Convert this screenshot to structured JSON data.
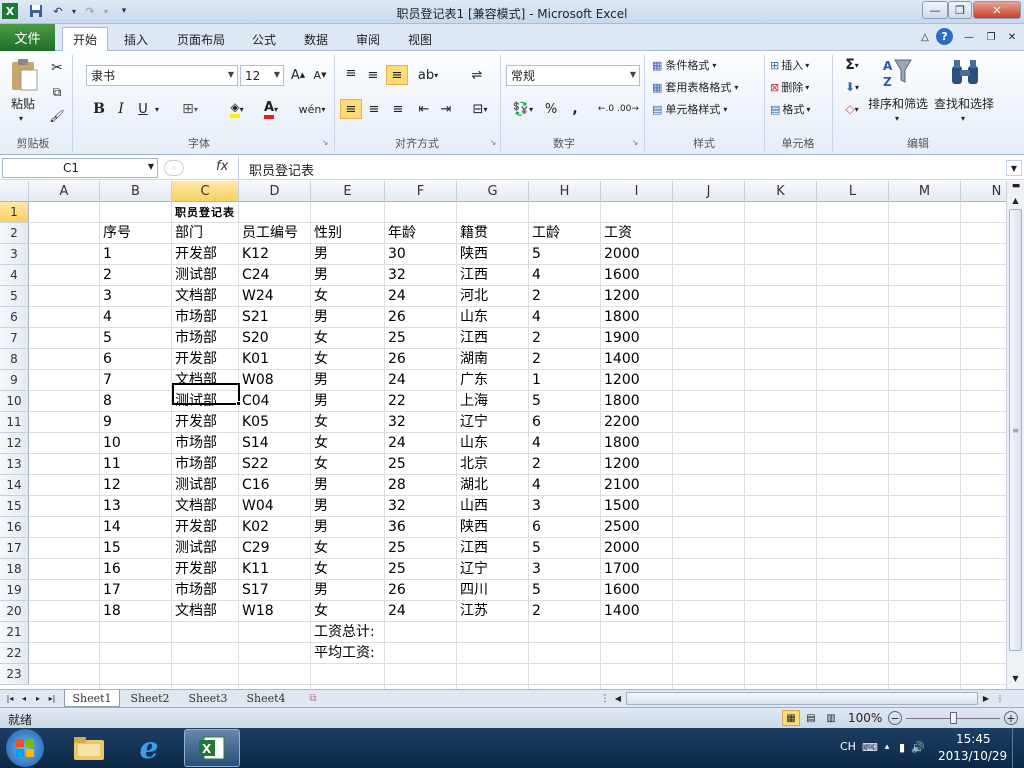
{
  "window": {
    "title": "职员登记表1  [兼容模式]  -  Microsoft Excel"
  },
  "tabs": [
    "文件",
    "开始",
    "插入",
    "页面布局",
    "公式",
    "数据",
    "审阅",
    "视图"
  ],
  "ribbon": {
    "clipboard": {
      "paste": "粘贴",
      "label": "剪贴板"
    },
    "font": {
      "name": "隶书",
      "size": "12",
      "label": "字体",
      "bold": "B",
      "italic": "I",
      "underline": "U"
    },
    "alignment": {
      "label": "对齐方式"
    },
    "number": {
      "format": "常规",
      "label": "数字",
      "percent": "%",
      "comma": ","
    },
    "styles": {
      "conditional": "条件格式",
      "table": "套用表格格式",
      "cell": "单元格样式",
      "label": "样式"
    },
    "cells": {
      "insert": "插入",
      "delete": "删除",
      "format": "格式",
      "label": "单元格"
    },
    "editing": {
      "sort": "排序和筛选",
      "find": "查找和选择",
      "label": "编辑",
      "sum": "Σ"
    }
  },
  "formula_bar": {
    "cell_ref": "C1",
    "fx": "fx",
    "value": "职员登记表"
  },
  "columns": [
    "A",
    "B",
    "C",
    "D",
    "E",
    "F",
    "G",
    "H",
    "I",
    "J",
    "K",
    "L",
    "M",
    "N"
  ],
  "rows": [
    "1",
    "2",
    "3",
    "4",
    "5",
    "6",
    "7",
    "8",
    "9",
    "10",
    "11",
    "12",
    "13",
    "14",
    "15",
    "16",
    "17",
    "18",
    "19",
    "20",
    "21",
    "22",
    "23"
  ],
  "sheet": {
    "title": "职员登记表",
    "headers": [
      "序号",
      "部门",
      "员工编号",
      "性别",
      "年龄",
      "籍贯",
      "工龄",
      "工资"
    ],
    "records": [
      [
        "1",
        "开发部",
        "K12",
        "男",
        "30",
        "陕西",
        "5",
        "2000"
      ],
      [
        "2",
        "测试部",
        "C24",
        "男",
        "32",
        "江西",
        "4",
        "1600"
      ],
      [
        "3",
        "文档部",
        "W24",
        "女",
        "24",
        "河北",
        "2",
        "1200"
      ],
      [
        "4",
        "市场部",
        "S21",
        "男",
        "26",
        "山东",
        "4",
        "1800"
      ],
      [
        "5",
        "市场部",
        "S20",
        "女",
        "25",
        "江西",
        "2",
        "1900"
      ],
      [
        "6",
        "开发部",
        "K01",
        "女",
        "26",
        "湖南",
        "2",
        "1400"
      ],
      [
        "7",
        "文档部",
        "W08",
        "男",
        "24",
        "广东",
        "1",
        "1200"
      ],
      [
        "8",
        "测试部",
        "C04",
        "男",
        "22",
        "上海",
        "5",
        "1800"
      ],
      [
        "9",
        "开发部",
        "K05",
        "女",
        "32",
        "辽宁",
        "6",
        "2200"
      ],
      [
        "10",
        "市场部",
        "S14",
        "女",
        "24",
        "山东",
        "4",
        "1800"
      ],
      [
        "11",
        "市场部",
        "S22",
        "女",
        "25",
        "北京",
        "2",
        "1200"
      ],
      [
        "12",
        "测试部",
        "C16",
        "男",
        "28",
        "湖北",
        "4",
        "2100"
      ],
      [
        "13",
        "文档部",
        "W04",
        "男",
        "32",
        "山西",
        "3",
        "1500"
      ],
      [
        "14",
        "开发部",
        "K02",
        "男",
        "36",
        "陕西",
        "6",
        "2500"
      ],
      [
        "15",
        "测试部",
        "C29",
        "女",
        "25",
        "江西",
        "5",
        "2000"
      ],
      [
        "16",
        "开发部",
        "K11",
        "女",
        "25",
        "辽宁",
        "3",
        "1700"
      ],
      [
        "17",
        "市场部",
        "S17",
        "男",
        "26",
        "四川",
        "5",
        "1600"
      ],
      [
        "18",
        "文档部",
        "W18",
        "女",
        "24",
        "江苏",
        "2",
        "1400"
      ]
    ],
    "total_label": "工资总计:",
    "avg_label": "平均工资:"
  },
  "sheet_tabs": [
    "Sheet1",
    "Sheet2",
    "Sheet3",
    "Sheet4"
  ],
  "status": {
    "ready": "就绪",
    "zoom": "100%"
  },
  "taskbar": {
    "lang": "CH",
    "time": "15:45",
    "date": "2013/10/29"
  }
}
